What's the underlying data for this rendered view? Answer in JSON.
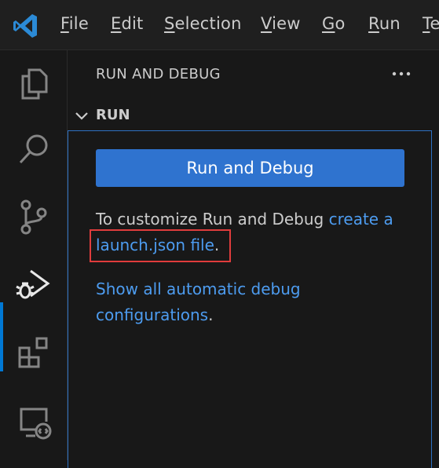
{
  "menu": {
    "items": [
      "File",
      "Edit",
      "Selection",
      "View",
      "Go",
      "Run",
      "Te"
    ],
    "mnemonics": [
      "F",
      "E",
      "S",
      "V",
      "G",
      "R",
      "T"
    ]
  },
  "activity_bar": {
    "items": [
      "explorer",
      "search",
      "source-control",
      "run-and-debug",
      "extensions",
      "remote-explorer"
    ],
    "active": "run-and-debug"
  },
  "sidebar": {
    "title": "RUN AND DEBUG",
    "section": {
      "title": "RUN",
      "expanded": true,
      "button_label": "Run and Debug",
      "customize_text": "To customize Run and Debug ",
      "customize_link_part1": "create a",
      "customize_link_part2": "launch.json file",
      "customize_tail": ".",
      "show_link_line1": "Show all automatic debug",
      "show_link_line2": "configurations",
      "show_tail": "."
    }
  },
  "colors": {
    "accent": "#0078d4",
    "button": "#2f73cf",
    "link": "#4d9cf0",
    "highlight_box": "#e03c3c"
  }
}
